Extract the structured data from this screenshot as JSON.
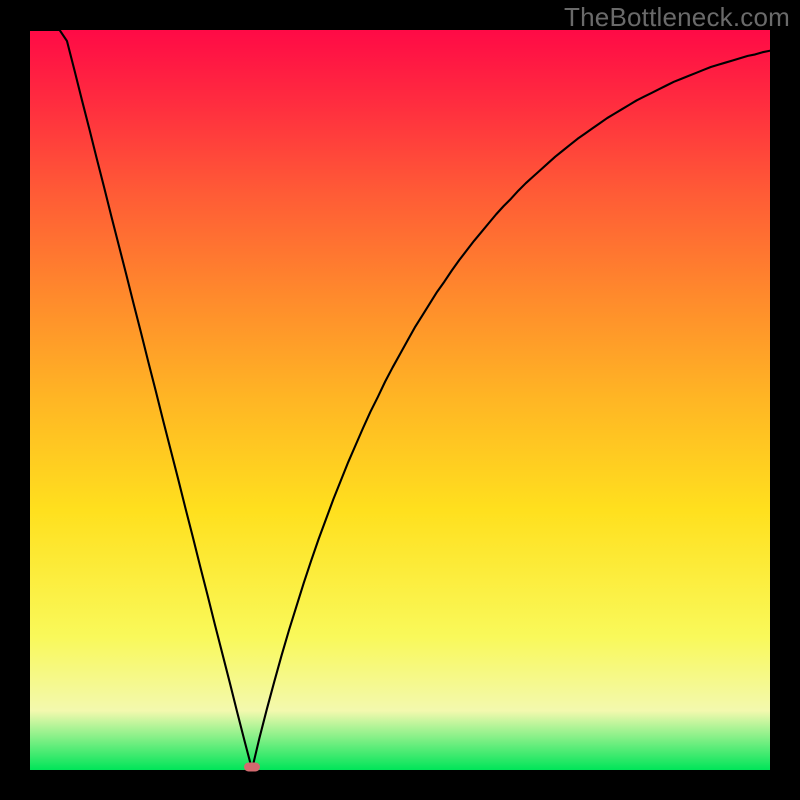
{
  "watermark": "TheBottleneck.com",
  "chart_data": {
    "type": "line",
    "title": "",
    "xlabel": "",
    "ylabel": "",
    "x": [
      0.0,
      0.01,
      0.02,
      0.03,
      0.04,
      0.05,
      0.06,
      0.07,
      0.08,
      0.09,
      0.1,
      0.11,
      0.12,
      0.13,
      0.14,
      0.15,
      0.16,
      0.17,
      0.18,
      0.19,
      0.2,
      0.21,
      0.22,
      0.23,
      0.24,
      0.25,
      0.26,
      0.27,
      0.28,
      0.29,
      0.3,
      0.31,
      0.32,
      0.33,
      0.34,
      0.35,
      0.36,
      0.37,
      0.38,
      0.39,
      0.4,
      0.41,
      0.42,
      0.43,
      0.44,
      0.45,
      0.46,
      0.47,
      0.48,
      0.49,
      0.5,
      0.51,
      0.52,
      0.53,
      0.54,
      0.55,
      0.56,
      0.57,
      0.58,
      0.59,
      0.6,
      0.61,
      0.62,
      0.63,
      0.64,
      0.65,
      0.66,
      0.67,
      0.68,
      0.69,
      0.7,
      0.71,
      0.72,
      0.73,
      0.74,
      0.75,
      0.76,
      0.77,
      0.78,
      0.79,
      0.8,
      0.81,
      0.82,
      0.83,
      0.84,
      0.85,
      0.86,
      0.87,
      0.88,
      0.89,
      0.9,
      0.91,
      0.92,
      0.93,
      0.94,
      0.95,
      0.96,
      0.97,
      0.98,
      0.99,
      1.0
    ],
    "values": [
      1.182,
      1.143,
      1.103,
      1.064,
      1.024,
      0.985,
      0.946,
      0.906,
      0.867,
      0.827,
      0.788,
      0.748,
      0.709,
      0.67,
      0.63,
      0.591,
      0.551,
      0.512,
      0.472,
      0.433,
      0.394,
      0.354,
      0.315,
      0.275,
      0.236,
      0.196,
      0.157,
      0.118,
      0.078,
      0.039,
      0.001,
      0.043,
      0.082,
      0.119,
      0.155,
      0.189,
      0.221,
      0.253,
      0.283,
      0.312,
      0.339,
      0.366,
      0.391,
      0.416,
      0.439,
      0.462,
      0.484,
      0.504,
      0.525,
      0.544,
      0.562,
      0.58,
      0.598,
      0.614,
      0.63,
      0.646,
      0.66,
      0.675,
      0.689,
      0.702,
      0.715,
      0.727,
      0.739,
      0.751,
      0.762,
      0.772,
      0.783,
      0.793,
      0.802,
      0.811,
      0.82,
      0.829,
      0.837,
      0.845,
      0.853,
      0.86,
      0.867,
      0.874,
      0.881,
      0.887,
      0.893,
      0.899,
      0.905,
      0.91,
      0.915,
      0.92,
      0.925,
      0.93,
      0.934,
      0.938,
      0.942,
      0.946,
      0.95,
      0.953,
      0.956,
      0.959,
      0.962,
      0.965,
      0.967,
      0.97,
      0.972
    ],
    "xlim": [
      0,
      1
    ],
    "ylim": [
      0,
      1
    ],
    "marker": {
      "x": 0.3,
      "y": 0.0
    },
    "gradient_stops": [
      {
        "pos": 0.0,
        "color": "#ff0a46"
      },
      {
        "pos": 0.1,
        "color": "#ff2d3f"
      },
      {
        "pos": 0.22,
        "color": "#ff5b36"
      },
      {
        "pos": 0.36,
        "color": "#ff8a2c"
      },
      {
        "pos": 0.5,
        "color": "#ffb624"
      },
      {
        "pos": 0.65,
        "color": "#ffe01e"
      },
      {
        "pos": 0.82,
        "color": "#f9f95a"
      },
      {
        "pos": 0.92,
        "color": "#f3f9ae"
      },
      {
        "pos": 1.0,
        "color": "#00e559"
      }
    ]
  }
}
